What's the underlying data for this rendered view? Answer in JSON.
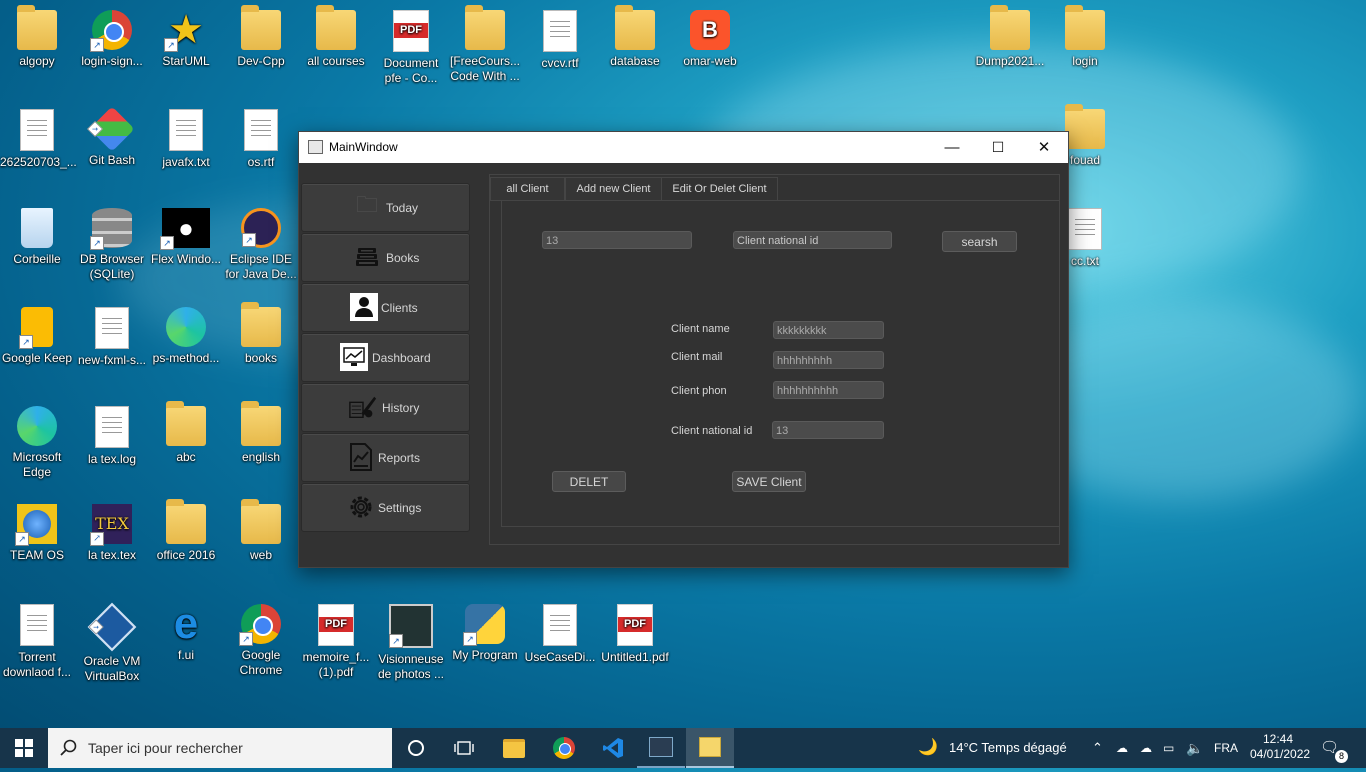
{
  "desktop": {
    "icons": [
      {
        "label": "algopy",
        "kind": "folder"
      },
      {
        "label": "login-sign...",
        "kind": "chrome"
      },
      {
        "label": "StarUML",
        "kind": "star"
      },
      {
        "label": "Dev-Cpp",
        "kind": "folder"
      },
      {
        "label": "all courses",
        "kind": "folder"
      },
      {
        "label": "Document pfe - Co...",
        "kind": "pdf"
      },
      {
        "label": "[FreeCours... Code With ...",
        "kind": "folder"
      },
      {
        "label": "cvcv.rtf",
        "kind": "doc"
      },
      {
        "label": "database",
        "kind": "folder"
      },
      {
        "label": "omar-web",
        "kind": "brave"
      },
      {
        "label": "Dump2021...",
        "kind": "folder"
      },
      {
        "label": "login",
        "kind": "folder"
      },
      {
        "label": "262520703_...",
        "kind": "doc"
      },
      {
        "label": "Git Bash",
        "kind": "git"
      },
      {
        "label": "javafx.txt",
        "kind": "doc"
      },
      {
        "label": "os.rtf",
        "kind": "doc"
      },
      {
        "label": "fouad",
        "kind": "folder"
      },
      {
        "label": "Corbeille",
        "kind": "bin"
      },
      {
        "label": "DB Browser (SQLite)",
        "kind": "db"
      },
      {
        "label": "Flex Windo...",
        "kind": "apple"
      },
      {
        "label": "Eclipse IDE for Java De...",
        "kind": "eclipse"
      },
      {
        "label": "cc.txt",
        "kind": "doc"
      },
      {
        "label": "Google Keep",
        "kind": "keep"
      },
      {
        "label": "new-fxml-s...",
        "kind": "doc"
      },
      {
        "label": "ps-method...",
        "kind": "edge"
      },
      {
        "label": "books",
        "kind": "folder"
      },
      {
        "label": "Microsoft Edge",
        "kind": "edge"
      },
      {
        "label": "la tex.log",
        "kind": "doc"
      },
      {
        "label": "abc",
        "kind": "folder"
      },
      {
        "label": "english",
        "kind": "folder"
      },
      {
        "label": "TEAM OS",
        "kind": "globe"
      },
      {
        "label": "la tex.tex",
        "kind": "tex"
      },
      {
        "label": "office 2016",
        "kind": "folder"
      },
      {
        "label": "web",
        "kind": "folder"
      },
      {
        "label": "Torrent downlaod f...",
        "kind": "doc"
      },
      {
        "label": "Oracle VM VirtualBox",
        "kind": "vbox"
      },
      {
        "label": "f.ui",
        "kind": "ie"
      },
      {
        "label": "Google Chrome",
        "kind": "chrome"
      },
      {
        "label": "memoire_f... (1).pdf",
        "kind": "pdf"
      },
      {
        "label": "Visionneuse de photos ...",
        "kind": "photo"
      },
      {
        "label": "My Program",
        "kind": "python"
      },
      {
        "label": "UseCaseDi...",
        "kind": "doc"
      },
      {
        "label": "Untitled1.pdf",
        "kind": "pdf"
      }
    ]
  },
  "window": {
    "title": "MainWindow",
    "minimize": "—",
    "maximize": "☐",
    "close": "✕"
  },
  "sidebar": {
    "items": [
      {
        "label": "Today",
        "icon": "folder-icon"
      },
      {
        "label": "Books",
        "icon": "books-icon"
      },
      {
        "label": "Clients",
        "icon": "user-icon"
      },
      {
        "label": "Dashboard",
        "icon": "chart-icon"
      },
      {
        "label": "History",
        "icon": "history-icon"
      },
      {
        "label": "Reports",
        "icon": "report-icon"
      },
      {
        "label": "Settings",
        "icon": "gear-icon"
      }
    ]
  },
  "tabs": [
    {
      "label": "all Client"
    },
    {
      "label": "Add new Client"
    },
    {
      "label": "Edit Or Delet Client"
    }
  ],
  "edit_form": {
    "id_value": "13",
    "national_id_placeholder": "Client national id",
    "search_label": "searsh",
    "name_label": "Client name",
    "name_value": "kkkkkkkkk",
    "mail_label": "Client mail",
    "mail_value": "hhhhhhhhh",
    "phone_label": "Client phon",
    "phone_value": "hhhhhhhhhh",
    "national_label": "Client national id",
    "national_value": "13",
    "delete_label": "DELET",
    "save_label": "SAVE Client"
  },
  "taskbar": {
    "search_placeholder": "Taper ici pour rechercher",
    "weather": "14°C  Temps dégagé",
    "lang": "FRA",
    "time": "12:44",
    "date": "04/01/2022",
    "notif_count": "8"
  }
}
